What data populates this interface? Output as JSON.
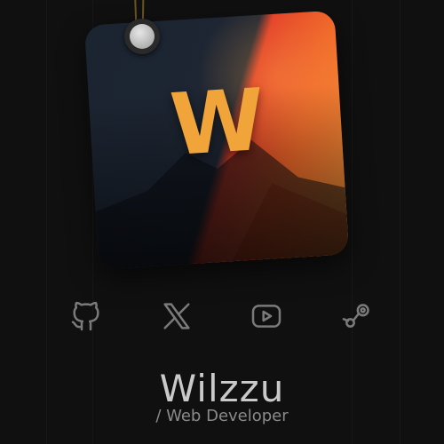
{
  "profile": {
    "logo_letter": "W",
    "name": "Wilzzu",
    "role": "/ Web Developer"
  },
  "socials": [
    {
      "icon": "github-icon"
    },
    {
      "icon": "x-icon"
    },
    {
      "icon": "youtube-icon"
    },
    {
      "icon": "steam-icon"
    }
  ],
  "colors": {
    "background": "#101010",
    "card_dark": "#1e2633",
    "card_red": "#e23c27",
    "card_orange": "#f49a3b",
    "logo": "#f0a43a",
    "text_primary": "#c9c9c9",
    "text_secondary": "#8a8a8a",
    "icon": "#7a7a7a"
  }
}
